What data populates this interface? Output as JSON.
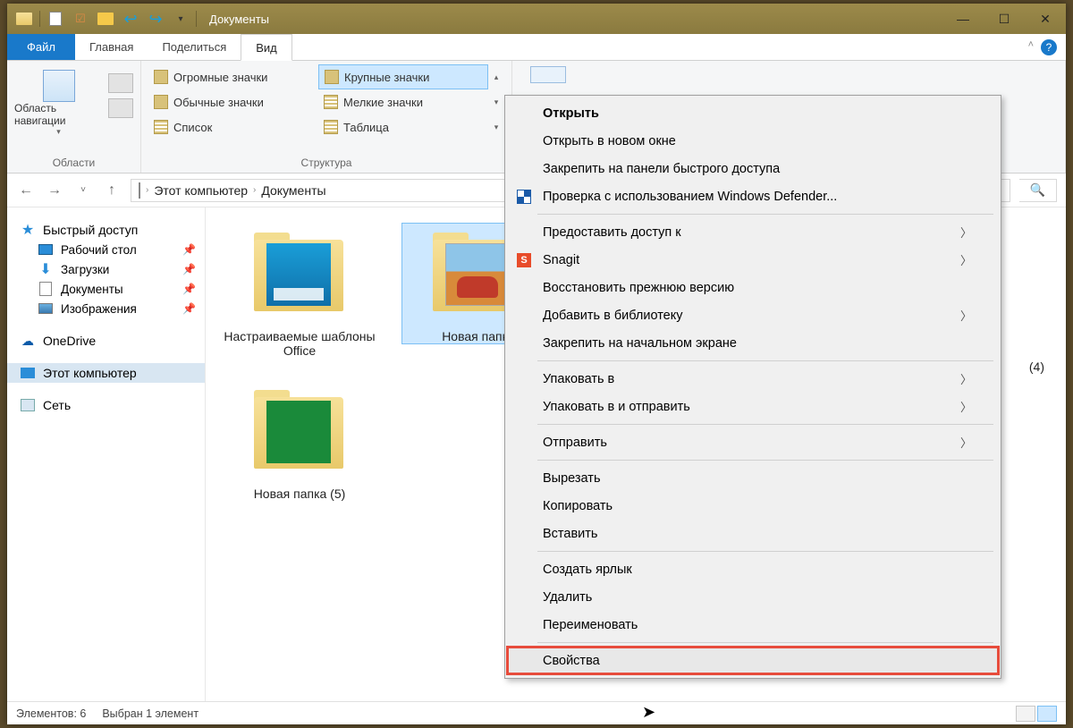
{
  "titlebar": {
    "title": "Документы"
  },
  "ribbon_tabs": {
    "file": "Файл",
    "home": "Главная",
    "share": "Поделиться",
    "view": "Вид"
  },
  "ribbon": {
    "nav_button": "Область навигации",
    "group_panes": "Области",
    "layout": {
      "huge": "Огромные значки",
      "large": "Крупные значки",
      "medium": "Обычные значки",
      "small": "Мелкие значки",
      "list": "Список",
      "table": "Таблица"
    },
    "group_layout": "Структура"
  },
  "breadcrumb": {
    "root": "Этот компьютер",
    "current": "Документы"
  },
  "sidebar": {
    "quick_access": "Быстрый доступ",
    "desktop": "Рабочий стол",
    "downloads": "Загрузки",
    "documents": "Документы",
    "pictures": "Изображения",
    "onedrive": "OneDrive",
    "this_pc": "Этот компьютер",
    "network": "Сеть"
  },
  "folders": {
    "f1": "Настраиваемые шаблоны Office",
    "f2": "Новая папка",
    "f3": "Новая папка (5)",
    "hidden_suffix": "(4)"
  },
  "status": {
    "count": "Элементов: 6",
    "selection": "Выбран 1 элемент"
  },
  "context_menu": {
    "open": "Открыть",
    "open_new": "Открыть в новом окне",
    "pin_quick": "Закрепить на панели быстрого доступа",
    "defender": "Проверка с использованием Windows Defender...",
    "give_access": "Предоставить доступ к",
    "snagit": "Snagit",
    "restore": "Восстановить прежнюю версию",
    "library": "Добавить в библиотеку",
    "pin_start": "Закрепить на начальном экране",
    "pack": "Упаковать в",
    "pack_send": "Упаковать в и отправить",
    "send_to": "Отправить",
    "cut": "Вырезать",
    "copy": "Копировать",
    "paste": "Вставить",
    "shortcut": "Создать ярлык",
    "delete": "Удалить",
    "rename": "Переименовать",
    "properties": "Свойства"
  }
}
